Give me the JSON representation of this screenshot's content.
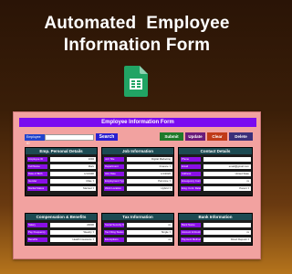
{
  "banner": {
    "title_line1": "Automated  Employee",
    "title_line2": "Information Form",
    "icon": "google-sheets-icon"
  },
  "form": {
    "title": "Employee Information Form",
    "employee_id_label": "Employee ID",
    "search_label": "Search",
    "buttons": {
      "submit": "Submit",
      "update": "Update",
      "clear": "Clear",
      "delete": "Delete"
    }
  },
  "sections": {
    "personal": {
      "title": "Emp. Personal Details",
      "fields": [
        {
          "label": "Employee ID",
          "value": "1004"
        },
        {
          "label": "Full Name",
          "value": "Mark"
        },
        {
          "label": "Date of Birth",
          "value": "1/1/1990"
        },
        {
          "label": "Gender",
          "value": "Male"
        },
        {
          "label": "Marital Status",
          "value": "Married"
        }
      ]
    },
    "job": {
      "title": "Job Information",
      "fields": [
        {
          "label": "Job Title",
          "value": "Digital Marketing"
        },
        {
          "label": "Department",
          "value": "Finance"
        },
        {
          "label": "Hire Date",
          "value": "1/1/2020"
        },
        {
          "label": "Employment Type",
          "value": "Part-time"
        },
        {
          "label": "Work Location",
          "value": "Hybrid"
        }
      ]
    },
    "contact": {
      "title": "Contact Details",
      "fields": [
        {
          "label": "Phone",
          "value": ""
        },
        {
          "label": "Email",
          "value": "email@gmail.com"
        },
        {
          "label": "Address",
          "value": "United State"
        },
        {
          "label": "Emergency Contact",
          "value": "xx"
        },
        {
          "label": "Emg. Cont. Relationship",
          "value": "Parent"
        }
      ]
    },
    "comp": {
      "title": "Compensation & Benefits",
      "fields": [
        {
          "label": "Salary",
          "value": "20000"
        },
        {
          "label": "Pay Frequency",
          "value": "Weekly"
        },
        {
          "label": "Benefits",
          "value": "Health Insurance"
        }
      ]
    },
    "tax": {
      "title": "Tax Information",
      "fields": [
        {
          "label": "Social Security Number (SSN)",
          "value": "xx"
        },
        {
          "label": "Tax Filing Status",
          "value": "Single"
        },
        {
          "label": "Exemptions",
          "value": "xx"
        }
      ]
    },
    "bank": {
      "title": "Bank Information",
      "fields": [
        {
          "label": "Bank Name",
          "value": ""
        },
        {
          "label": "Account & Routing Number",
          "value": "xx"
        },
        {
          "label": "Payment Method",
          "value": "Direct Deposit"
        }
      ]
    }
  },
  "colors": {
    "label_purple": "#8a10e6",
    "section_header": "#1c4a52",
    "form_bg": "#f2a2a0",
    "header_bar": "#7a0cf0"
  }
}
